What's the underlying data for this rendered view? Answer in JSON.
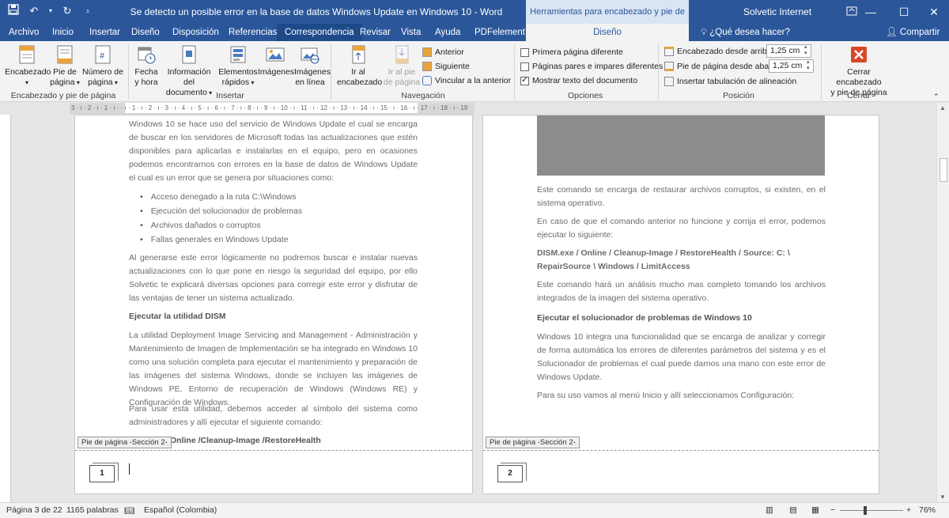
{
  "titlebar": {
    "doc_title": "Se detecto un posible error en la base de datos Windows Update en Windows 10  -  Word",
    "context_title": "Herramientas para encabezado y pie de página",
    "user": "Solvetic Internet"
  },
  "tabs": {
    "items": [
      "Archivo",
      "Inicio",
      "Insertar",
      "Diseño",
      "Disposición",
      "Referencias",
      "Correspondencia",
      "Revisar",
      "Vista",
      "Ayuda",
      "PDFelement"
    ],
    "context_tab": "Diseño",
    "tell_me": "¿Qué desea hacer?",
    "share": "Compartir"
  },
  "ribbon": {
    "header_footer_group": {
      "label": "Encabezado y pie de página",
      "header": [
        "Encabezado",
        ""
      ],
      "footer": [
        "Pie de",
        "página"
      ],
      "page_number": [
        "Número de",
        "página"
      ]
    },
    "insert_group": {
      "label": "Insertar",
      "date_time": [
        "Fecha",
        "y hora"
      ],
      "doc_info": [
        "Información del",
        "documento"
      ],
      "quick_parts": [
        "Elementos",
        "rápidos"
      ],
      "pictures": [
        "Imágenes",
        ""
      ],
      "online_pictures": [
        "Imágenes",
        "en línea"
      ]
    },
    "nav_group": {
      "label": "Navegación",
      "go_header": [
        "Ir al",
        "encabezado"
      ],
      "go_footer": [
        "Ir al pie",
        "de página"
      ],
      "previous": "Anterior",
      "next": "Siguiente",
      "link_previous": "Vincular a la anterior"
    },
    "options_group": {
      "label": "Opciones",
      "first_page": "Primera página diferente",
      "odd_even": "Páginas pares e impares diferentes",
      "show_text": "Mostrar texto del documento"
    },
    "position_group": {
      "label": "Posición",
      "header_from_top": "Encabezado desde arriba:",
      "header_from_top_value": "1,25 cm",
      "footer_from_bottom": "Pie de página desde abajo:",
      "footer_from_bottom_value": "1,25 cm",
      "insert_alignment_tab": "Insertar tabulación de alineación"
    },
    "close_group": {
      "label": "Cerrar",
      "close": [
        "Cerrar encabezado",
        "y pie de página"
      ]
    }
  },
  "ruler": {
    "text": "3 · ı · 2 · ı · 1 · ı ·  · ı · 1 · ı · 2 · ı · 3 · ı · 4 · ı · 5 · ı · 6 · ı · 7 · ı · 8 · ı · 9 · ı · 10 · ı · 11 · ı · 12 · ı · 13 · ı · 14 · ı · 15 · ı · 16 · ı · 17 · ı · 18 · ı · 19"
  },
  "page_left": {
    "para1": "Windows 10 se hace uso del servicio de Windows Update el cual se encarga de buscar en los servidores de Microsoft todas las actualizaciones que estén disponibles para aplicarlas e instalarlas en el equipo, pero en ocasiones podemos encontrarnos con errores en la base de datos de Windows Update el cual es un error que se genera por situaciones como:",
    "bullets": [
      "Acceso denegado a la ruta C:\\Windows",
      "Ejecución del solucionador de problemas",
      "Archivos dañados o corruptos",
      "Fallas generales en Windows Update"
    ],
    "para2": "Al generarse este error lógicamente no podremos buscar e instalar nuevas actualizaciones con lo que pone en riesgo la seguridad del equipo, por ello Solvetic te explicará diversas opciones para corregir este error y disfrutar de las ventajas de tener un sistema actualizado.",
    "heading": "Ejecutar la utilidad DISM",
    "para3": "La utilidad Deployment Image Servicing and Management - Administración y Mantenimiento de Imagen de Implementación se ha integrado en Windows 10 como una solución completa para ejecutar el mantenimiento y preparación de las imágenes del sistema Windows, donde se incluyen las imágenes de Windows PE, Entorno de recuperación de Windows (Windows RE) y Configuración de Windows.",
    "para4": "Para usar esta utilidad, debemos acceder al símbolo del sistema como administradores y allí ejecutar el siguiente comando:",
    "command": "Online /Cleanup-Image /RestoreHealth",
    "footer_tag": "Pie de página -Sección 2-",
    "page_number": "1"
  },
  "page_right": {
    "para1": "Este comando se encarga de restaurar archivos corruptos, si existen, en el sistema operativo.",
    "para2": "En caso de que el comando anterior no funcione y corrija el error, podemos ejecutar lo siguiente:",
    "command": "DISM.exe / Online / Cleanup-Image / RestoreHealth / Source: C: \\ RepairSource \\ Windows / LimitAccess",
    "para3": "Este comando hará un análisis mucho mas completo tomando los archivos integrados de la imagen del sistema operativo.",
    "heading": "Ejecutar el solucionador de problemas de Windows 10",
    "para4": "Windows 10 integra una funcionalidad que se encarga de analizar y corregir de forma automática los errores de diferentes parámetros del sistema y es el Solucionador de problemas el cual puede darnos una mano con este error de Windows Update.",
    "para5": "Para su uso vamos al menú Inicio y allí seleccionamos Configuración:",
    "footer_tag": "Pie de página -Sección 2-",
    "page_number": "2"
  },
  "statusbar": {
    "page": "Página 3 de 22",
    "words": "1165 palabras",
    "language": "Español (Colombia)",
    "zoom": "76%"
  },
  "colors": {
    "word_blue": "#2b579a",
    "close_red": "#d9472b"
  }
}
